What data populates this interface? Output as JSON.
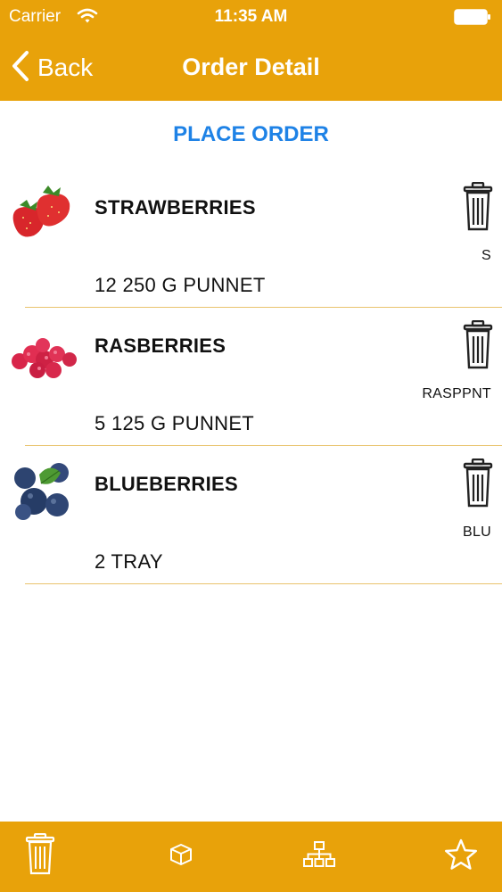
{
  "status_bar": {
    "carrier": "Carrier",
    "time": "11:35 AM"
  },
  "navbar": {
    "back_label": "Back",
    "title": "Order Detail"
  },
  "place_order_label": "PLACE ORDER",
  "items": [
    {
      "name": "STRAWBERRIES",
      "code": "S",
      "quantity": "12 250 G PUNNET",
      "image": "strawberries-photo"
    },
    {
      "name": "RASBERRIES",
      "code": "RASPPNT",
      "quantity": "5 125 G PUNNET",
      "image": "raspberries-photo"
    },
    {
      "name": "BLUEBERRIES",
      "code": "BLU",
      "quantity": "2 TRAY",
      "image": "blueberries-photo"
    }
  ],
  "tab_bar": {
    "tabs": [
      {
        "icon": "trash-icon"
      },
      {
        "icon": "box-icon"
      },
      {
        "icon": "hierarchy-icon"
      },
      {
        "icon": "star-icon"
      }
    ]
  },
  "colors": {
    "accent": "#E8A20A",
    "link": "#1E82E6",
    "separator": "#E9C36D"
  }
}
